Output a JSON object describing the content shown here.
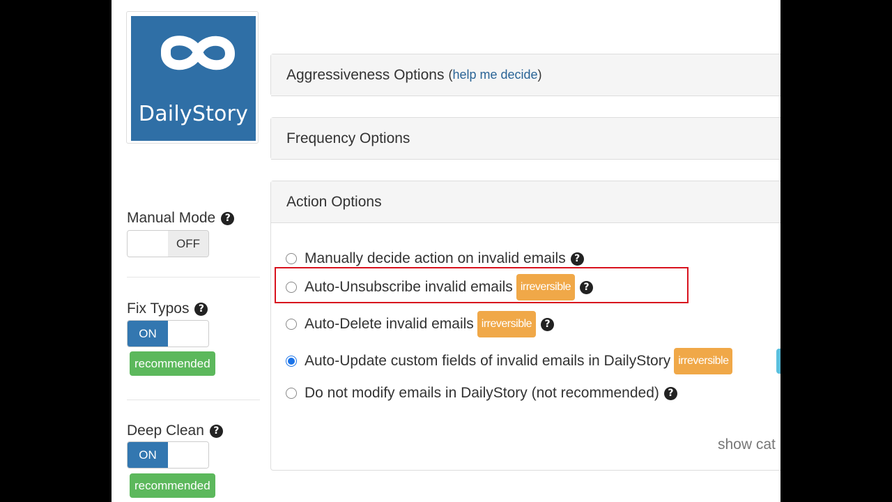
{
  "brand": {
    "logo_text": "DailyStory",
    "logo_color": "#2f6fa6"
  },
  "sidebar": {
    "manual_mode": {
      "label": "Manual Mode",
      "state": "OFF"
    },
    "fix_typos": {
      "label": "Fix Typos",
      "state": "ON",
      "badge": "recommended"
    },
    "deep_clean": {
      "label": "Deep Clean",
      "state": "ON",
      "badge": "recommended"
    }
  },
  "panels": {
    "aggressiveness": {
      "title": "Aggressiveness Options",
      "open_paren": "(",
      "help_link": "help me decide",
      "close_paren": ")"
    },
    "frequency": {
      "title": "Frequency Options"
    },
    "action": {
      "title": "Action Options",
      "options": [
        {
          "label": "Manually decide action on invalid emails",
          "selected": false
        },
        {
          "label": "Auto-Unsubscribe invalid emails",
          "badge": "irreversible",
          "selected": false
        },
        {
          "label": "Auto-Delete invalid emails",
          "badge": "irreversible",
          "selected": false
        },
        {
          "label": "Auto-Update custom fields of invalid emails in DailyStory",
          "badge": "irreversible",
          "selected": true
        },
        {
          "label": "Do not modify emails in DailyStory (not recommended)",
          "selected": false
        }
      ],
      "footer_link": "show cat"
    }
  },
  "colors": {
    "on": "#3377b0",
    "recommended": "#5cb85c",
    "irreversible": "#f0a848",
    "highlight": "#d8121e",
    "radio_selected": "#1a73e8"
  }
}
